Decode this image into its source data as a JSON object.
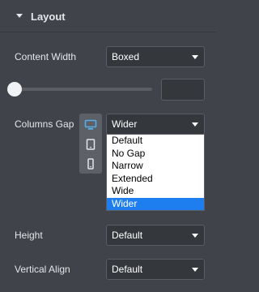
{
  "section": {
    "title": "Layout",
    "expanded": true
  },
  "content_width": {
    "label": "Content Width",
    "value": "Boxed"
  },
  "width_slider": {
    "value": ""
  },
  "columns_gap": {
    "label": "Columns Gap",
    "value": "Wider",
    "options": [
      "Default",
      "No Gap",
      "Narrow",
      "Extended",
      "Wide",
      "Wider"
    ],
    "selected_index": 5,
    "devices": [
      "desktop-icon",
      "tablet-icon",
      "mobile-icon"
    ],
    "active_device": "desktop"
  },
  "height": {
    "label": "Height",
    "value": "Default"
  },
  "vertical_align": {
    "label": "Vertical Align",
    "value": "Default"
  },
  "colors": {
    "panel_bg": "#404349",
    "accent": "#1e7ef0",
    "device_active": "#55aeea"
  }
}
